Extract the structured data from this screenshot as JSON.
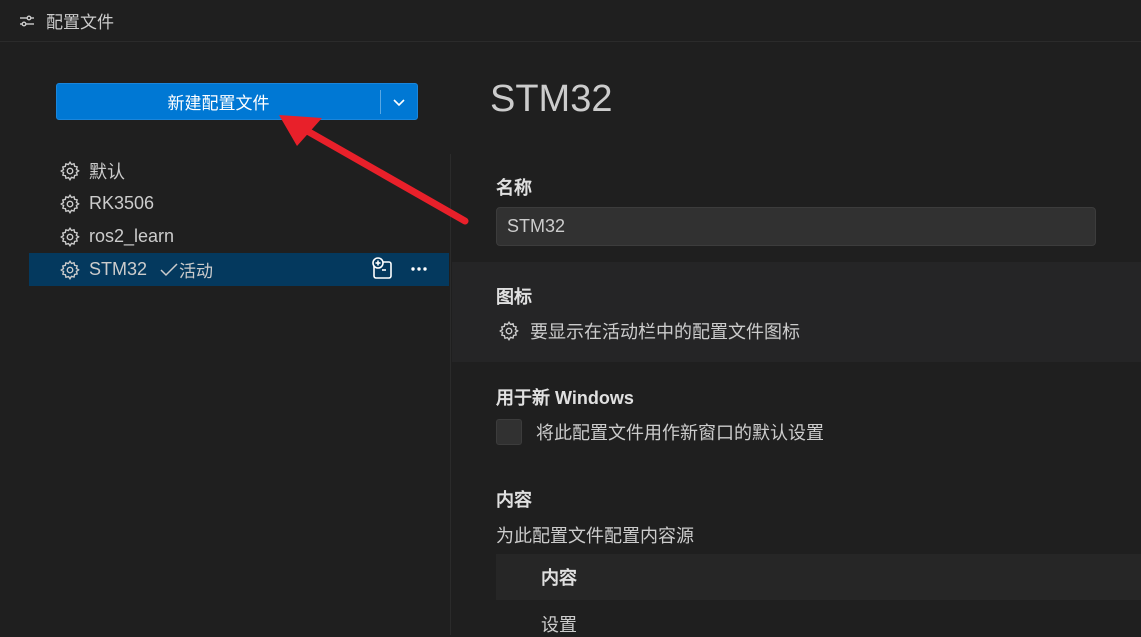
{
  "titlebar": {
    "title": "配置文件",
    "icon": "settings-sliders-icon"
  },
  "new_button": {
    "label": "新建配置文件",
    "dropdown_icon": "chevron-down-icon"
  },
  "profiles": [
    {
      "name": "默认",
      "active": false
    },
    {
      "name": "RK3506",
      "active": false
    },
    {
      "name": "ros2_learn",
      "active": false
    },
    {
      "name": "STM32",
      "active": true,
      "status": "活动"
    }
  ],
  "detail": {
    "title": "STM32",
    "name_label": "名称",
    "name_value": "STM32",
    "icon_label": "图标",
    "icon_desc": "要显示在活动栏中的配置文件图标",
    "windows_label": "用于新 Windows",
    "windows_checkbox": "将此配置文件用作新窗口的默认设置",
    "windows_checked": false,
    "content_label": "内容",
    "content_desc": "为此配置文件配置内容源",
    "table_header": "内容",
    "table_rows": [
      "设置"
    ]
  },
  "colors": {
    "accent": "#0078d4",
    "active_row": "#04395e",
    "annotation_arrow": "#e8202a"
  }
}
